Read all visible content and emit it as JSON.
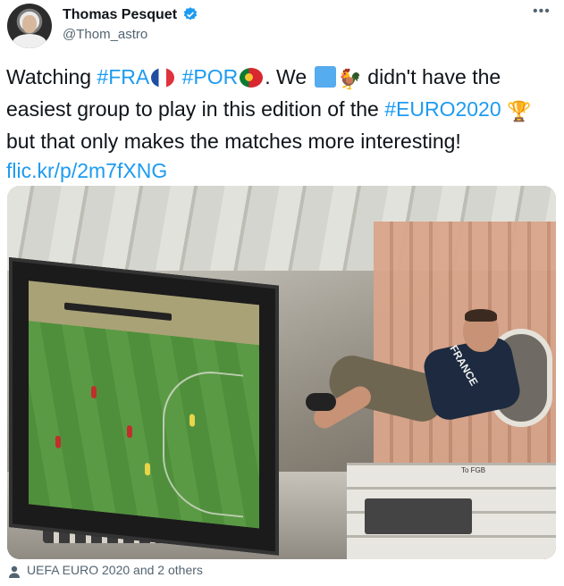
{
  "author": {
    "name": "Thomas Pesquet",
    "handle": "@Thom_astro",
    "verified": true
  },
  "menu_icon": "more-horizontal-icon",
  "tweet": {
    "w_watching": "Watching ",
    "tag_fra": "#FRA",
    "tag_por": "#POR",
    "w_we": ". We ",
    "w_didnt": " didn't have the easiest group to play in this edition of the ",
    "tag_euro": "#EURO2020",
    "w_but": " but that only makes the matches more interesting!",
    "link": "flic.kr/p/2m7fXNG",
    "emojis": [
      "flag-france",
      "flag-portugal",
      "blue-square",
      "rooster",
      "trophy"
    ]
  },
  "photo": {
    "alt_scene": "astronaut-watching-football-on-iss",
    "shirt_text": "FRANCE",
    "panel_label": "To FGB"
  },
  "footer": {
    "tagged_text": "UEFA EURO 2020 and 2 others",
    "icon": "person-icon"
  },
  "colors": {
    "link": "#1d9bf0",
    "text": "#0f1419",
    "secondary": "#536471",
    "verified": "#1d9bf0"
  }
}
